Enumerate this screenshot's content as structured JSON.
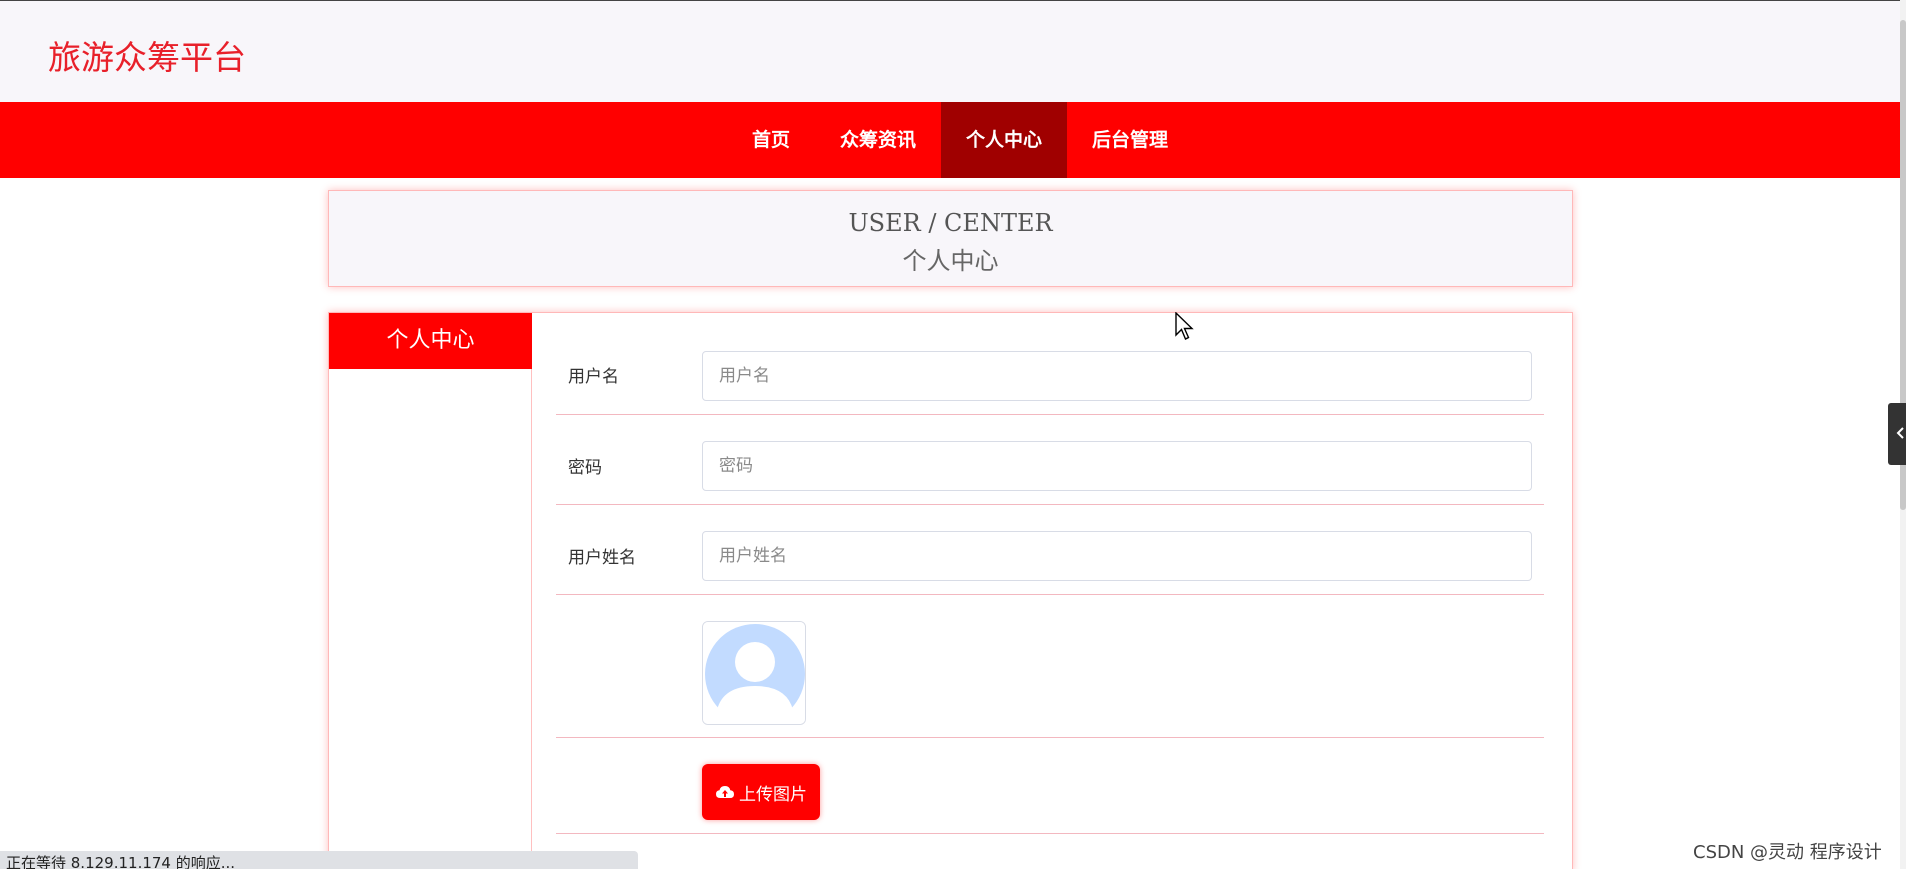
{
  "header": {
    "brand": "旅游众筹平台"
  },
  "nav": {
    "items": [
      {
        "label": "首页"
      },
      {
        "label": "众筹资讯"
      },
      {
        "label": "个人中心"
      },
      {
        "label": "后台管理"
      }
    ],
    "active": "个人中心"
  },
  "banner": {
    "title_en": "USER / CENTER",
    "title_cn": "个人中心"
  },
  "sidebar": {
    "items": [
      {
        "label": "个人中心"
      }
    ]
  },
  "form": {
    "username": {
      "label": "用户名",
      "placeholder": "用户名",
      "value": ""
    },
    "password": {
      "label": "密码",
      "placeholder": "密码",
      "value": ""
    },
    "realname": {
      "label": "用户姓名",
      "placeholder": "用户姓名",
      "value": ""
    },
    "upload_label": "上传图片"
  },
  "status": {
    "text": "正在等待 8.129.11.174 的响应..."
  },
  "watermark": "CSDN @灵动 程序设计",
  "colors": {
    "accent": "#ff0000",
    "accent_dark": "#a00000",
    "brand_text": "#e8202a"
  },
  "icons": {
    "upload": "cloud-upload-icon",
    "avatar": "user-avatar-icon"
  }
}
